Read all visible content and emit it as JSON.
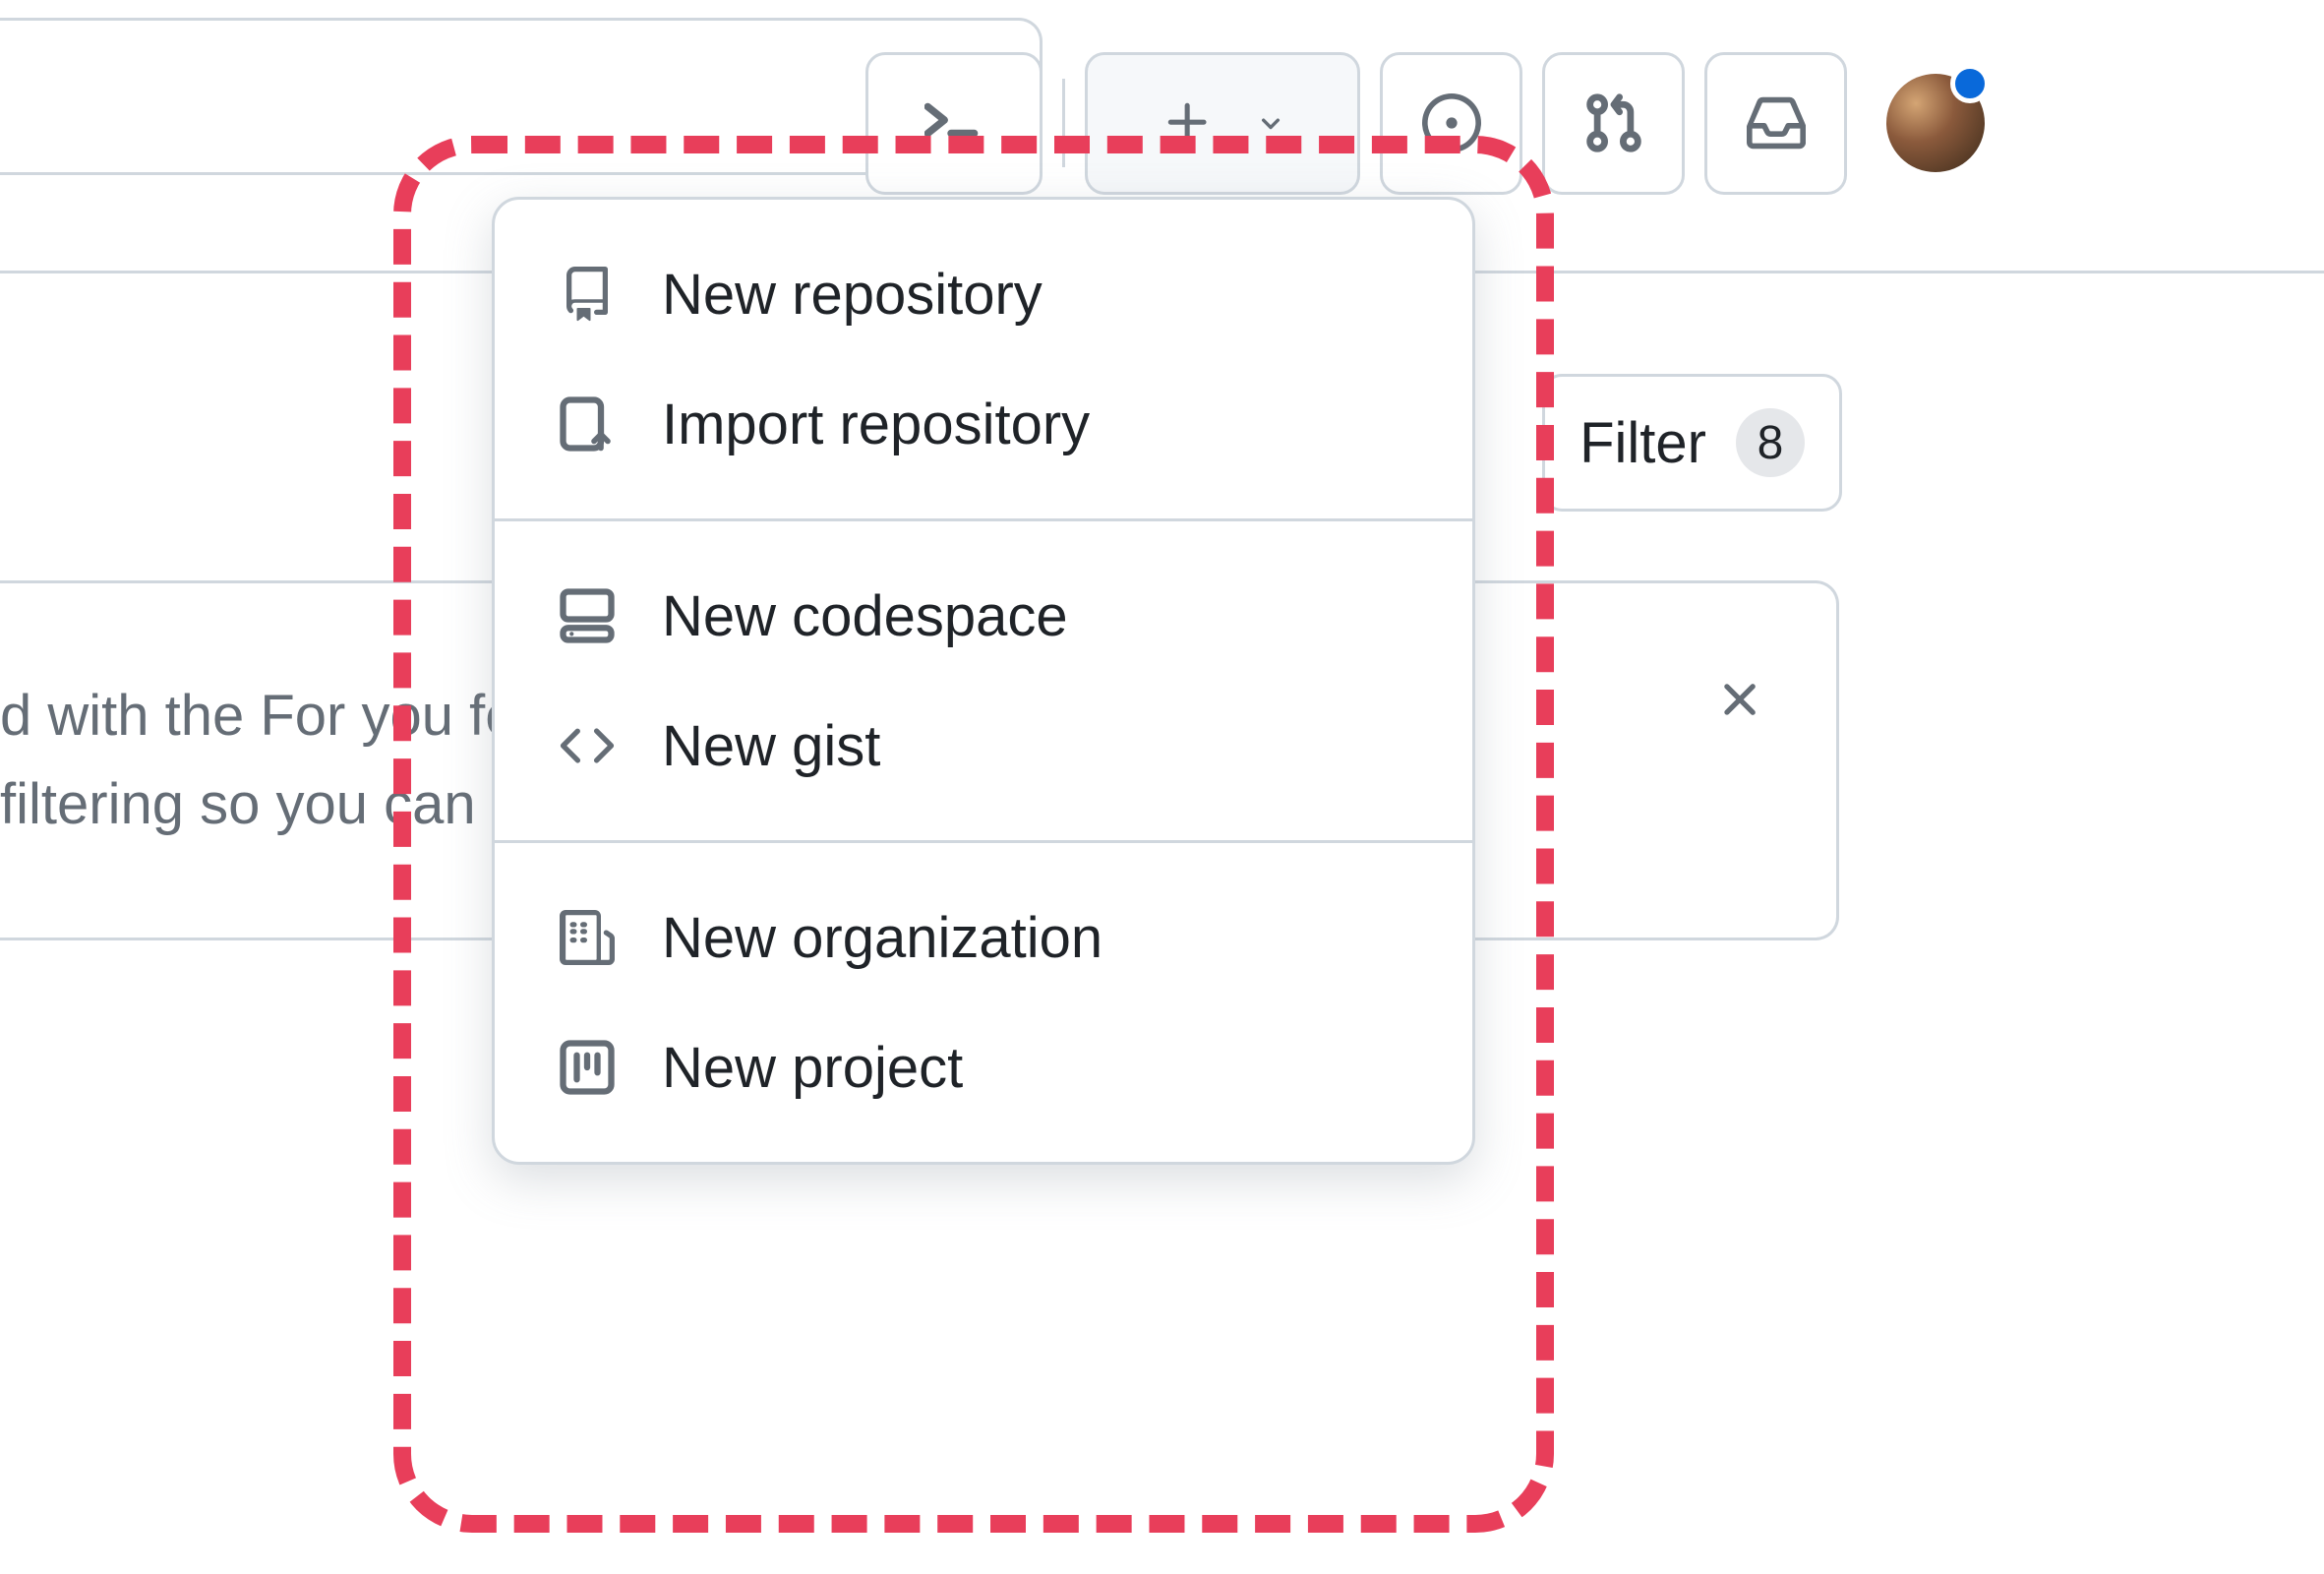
{
  "toolbar": {
    "search_placeholder": "",
    "command_palette": "Command palette",
    "create_new": "Create new",
    "issues": "Issues",
    "pull_requests": "Pull requests",
    "inbox": "Inbox"
  },
  "filter": {
    "label": "Filter",
    "count": "8"
  },
  "card": {
    "body": "d with the For you feed. We've also got brand new filtering so you can customize exactly how",
    "close": "Dismiss"
  },
  "dropdown": {
    "sections": [
      [
        {
          "icon": "repo",
          "label": "New repository"
        },
        {
          "icon": "repo-push",
          "label": "Import repository"
        }
      ],
      [
        {
          "icon": "codespace",
          "label": "New codespace"
        },
        {
          "icon": "code",
          "label": "New gist"
        }
      ],
      [
        {
          "icon": "organization",
          "label": "New organization"
        },
        {
          "icon": "project",
          "label": "New project"
        }
      ]
    ]
  }
}
